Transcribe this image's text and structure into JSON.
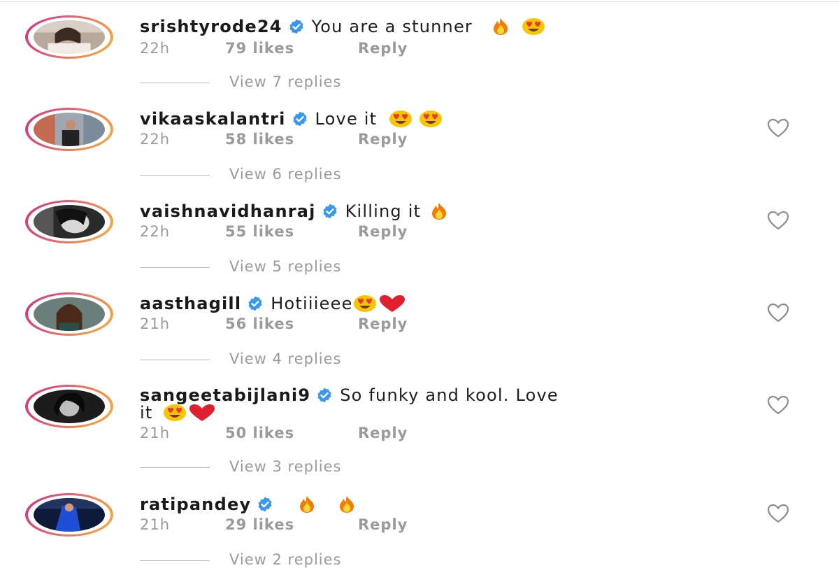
{
  "comments": [
    {
      "username": "srishtyrode24",
      "text": "You are a stunner",
      "emojis": [
        "fire",
        "heart-eyes"
      ],
      "wrap_text": "",
      "wrap_emojis": [],
      "time": "22h",
      "likes": "79 likes",
      "reply_label": "Reply",
      "view_replies": "View 7 replies",
      "has_like_button": false
    },
    {
      "username": "vikaaskalantri",
      "text": "Love it",
      "emojis": [
        "heart-eyes",
        "heart-eyes"
      ],
      "wrap_text": "",
      "wrap_emojis": [],
      "time": "22h",
      "likes": "58 likes",
      "reply_label": "Reply",
      "view_replies": "View 6 replies",
      "has_like_button": true
    },
    {
      "username": "vaishnavidhanraj",
      "text": "Killing it",
      "emojis": [
        "fire"
      ],
      "wrap_text": "",
      "wrap_emojis": [],
      "time": "22h",
      "likes": "55 likes",
      "reply_label": "Reply",
      "view_replies": "View 5 replies",
      "has_like_button": true
    },
    {
      "username": "aasthagill",
      "text": "Hotiiieee",
      "emojis": [
        "heart-eyes",
        "red-heart"
      ],
      "wrap_text": "",
      "wrap_emojis": [],
      "time": "21h",
      "likes": "56 likes",
      "reply_label": "Reply",
      "view_replies": "View 4 replies",
      "has_like_button": true
    },
    {
      "username": "sangeetabijlani9",
      "text": "So funky and kool. Love",
      "emojis": [],
      "wrap_text": "it",
      "wrap_emojis": [
        "heart-eyes",
        "red-heart"
      ],
      "time": "21h",
      "likes": "50 likes",
      "reply_label": "Reply",
      "view_replies": "View 3 replies",
      "has_like_button": true
    },
    {
      "username": "ratipandey",
      "text": "",
      "emojis": [
        "fire",
        "fire"
      ],
      "wrap_text": "",
      "wrap_emojis": [],
      "time": "21h",
      "likes": "29 likes",
      "reply_label": "Reply",
      "view_replies": "View 2 replies",
      "has_like_button": true
    }
  ],
  "icons": {
    "verified": "verified-badge-icon",
    "like": "heart-outline-icon"
  },
  "colors": {
    "verified_blue": "#3897f0",
    "meta_gray": "#9a9a9a",
    "story_ring_start": "#c9367a",
    "story_ring_end": "#f5b042"
  }
}
